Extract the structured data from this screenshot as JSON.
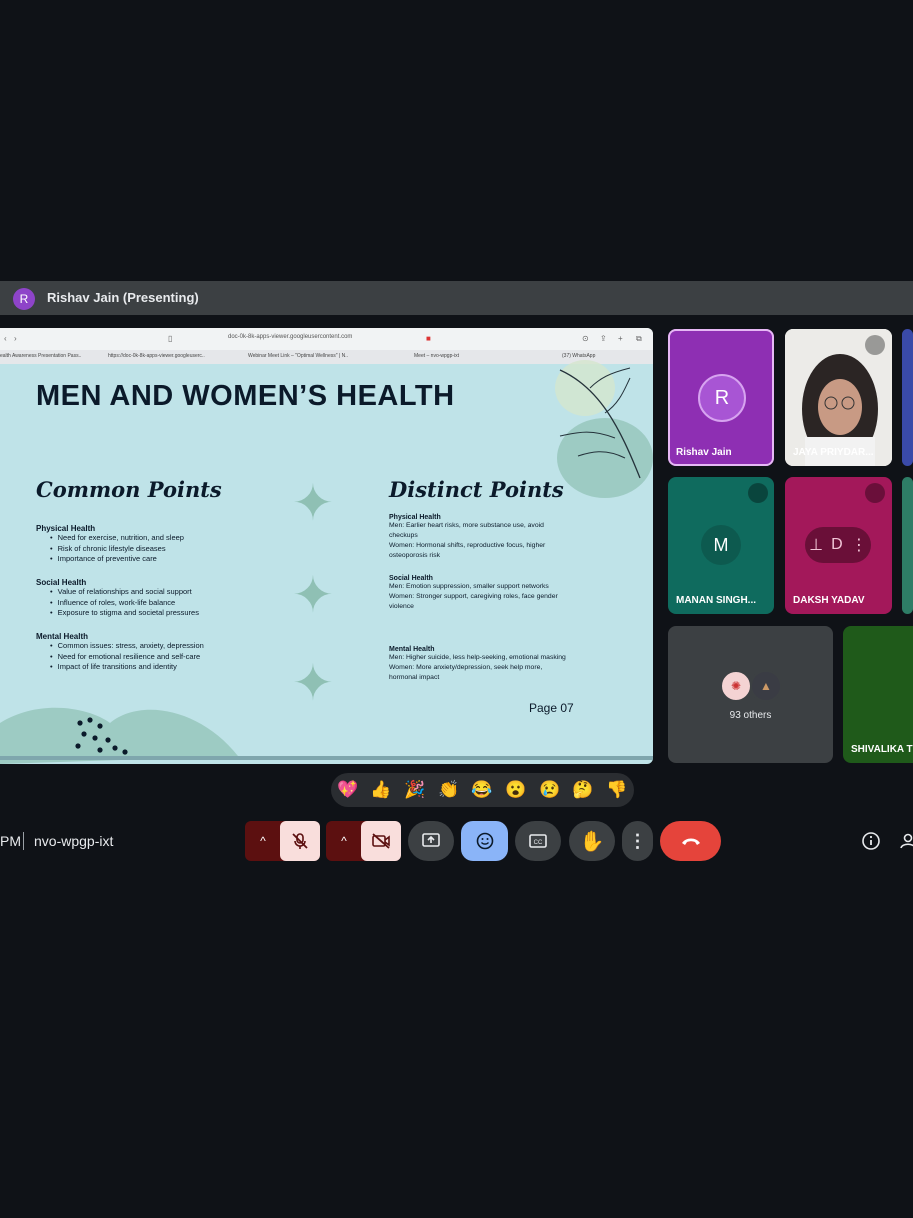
{
  "presenter_bar": {
    "avatar_letter": "R",
    "label": "Rishav Jain (Presenting)"
  },
  "slide": {
    "browser": {
      "url": "doc-0k-8k-apps-viewer.googleusercontent.com",
      "tabs": [
        "ealth Awareness Presentation Pass..",
        "https://doc-0k-8k-apps-viewer.googleuserc..",
        "Webinar Meet Link – \"Optimal Wellness\" | N..",
        "Meet – nvo-wpgp-ixt",
        "(37) WhatsApp"
      ]
    },
    "title": "MEN AND WOMEN’S HEALTH",
    "common": {
      "heading": "Common Points",
      "sections": [
        {
          "title": "Physical Health",
          "items": [
            "Need for exercise, nutrition, and sleep",
            "Risk of chronic lifestyle diseases",
            "Importance of preventive care"
          ]
        },
        {
          "title": "Social Health",
          "items": [
            "Value of relationships and social support",
            "Influence of roles, work-life balance",
            "Exposure to stigma and societal pressures"
          ]
        },
        {
          "title": "Mental Health",
          "items": [
            "Common issues: stress, anxiety, depression",
            "Need for emotional resilience and self-care",
            "Impact of life transitions and identity"
          ]
        }
      ]
    },
    "distinct": {
      "heading": "Distinct Points",
      "sections": [
        {
          "title": "Physical Health",
          "men": "Men: Earlier heart risks, more substance use, avoid checkups",
          "women": "Women: Hormonal shifts, reproductive focus, higher osteoporosis risk"
        },
        {
          "title": "Social Health",
          "men": "Men: Emotion suppression, smaller support networks",
          "women": "Women: Stronger support, caregiving roles, face gender violence"
        },
        {
          "title": "Mental Health",
          "men": "Men: Higher suicide, less help-seeking, emotional masking",
          "women": "Women: More anxiety/depression, seek help more, hormonal impact"
        }
      ]
    },
    "page": "Page 07"
  },
  "participants": [
    {
      "name": "Rishav Jain",
      "letter": "R",
      "color": "#8e2fb3"
    },
    {
      "name": "JAYA PRIYDAR...",
      "muted": true
    },
    {
      "name": "MANAN SINGH...",
      "letter": "M",
      "color": "#0f6b5e",
      "muted": true
    },
    {
      "name": "DAKSH YADAV",
      "letter": "D",
      "color": "#a3185a",
      "muted": true
    },
    {
      "name": "SHIVALIKA TH",
      "color": "#1f5a1a"
    }
  ],
  "others_label": "93 others",
  "reactions": [
    "💖",
    "👍",
    "🎉",
    "👏",
    "😂",
    "😮",
    "😢",
    "🤔",
    "👎"
  ],
  "footer": {
    "time_fragment": "PM",
    "meeting_code": "nvo-wpgp-ixt"
  },
  "colors": {
    "end_call": "#e5443b",
    "controls_off": "#5c1010",
    "active_blue": "#8ab4f8"
  }
}
